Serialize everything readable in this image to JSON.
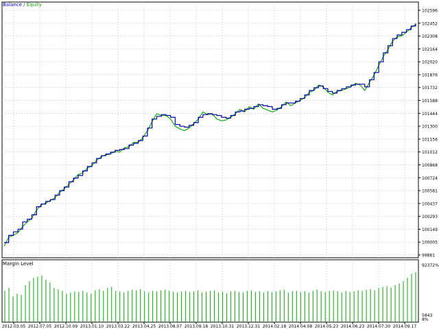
{
  "legend": {
    "balance": "Balance",
    "separator": " / ",
    "equity": "Equity"
  },
  "margin_panel": {
    "title": "Margin Level"
  },
  "colors": {
    "balance": "#0000a0",
    "equity": "#14aa14",
    "margin_bars": "#22aa22",
    "grid": "#c8c8c8",
    "axis": "#000000"
  },
  "chart_data": [
    {
      "type": "line",
      "series": [
        {
          "name": "Balance",
          "values": [
            100000,
            100080,
            100120,
            100150,
            100230,
            100260,
            100310,
            100400,
            100430,
            100460,
            100480,
            100530,
            100580,
            100620,
            100680,
            100720,
            100750,
            100800,
            100850,
            100890,
            100940,
            100970,
            100990,
            101010,
            101030,
            101040,
            101050,
            101090,
            101110,
            101140,
            101190,
            101280,
            101380,
            101410,
            101430,
            101420,
            101400,
            101320,
            101300,
            101290,
            101310,
            101340,
            101400,
            101430,
            101440,
            101430,
            101420,
            101400,
            101390,
            101420,
            101460,
            101470,
            101490,
            101500,
            101520,
            101540,
            101530,
            101520,
            101490,
            101500,
            101540,
            101560,
            101560,
            101580,
            101610,
            101650,
            101700,
            101730,
            101750,
            101720,
            101690,
            101670,
            101700,
            101720,
            101740,
            101760,
            101770,
            101770,
            101740,
            101820,
            101900,
            102020,
            102120,
            102200,
            102280,
            102320,
            102350,
            102380,
            102420,
            102450
          ]
        },
        {
          "name": "Equity",
          "values": [
            99960,
            100060,
            100080,
            100110,
            100180,
            100230,
            100270,
            100360,
            100420,
            100440,
            100470,
            100500,
            100560,
            100600,
            100650,
            100700,
            100760,
            100780,
            100830,
            100860,
            100920,
            100960,
            100980,
            100990,
            101020,
            101010,
            101060,
            101070,
            101120,
            101120,
            101170,
            101250,
            101350,
            101440,
            101420,
            101420,
            101380,
            101300,
            101270,
            101250,
            101280,
            101330,
            101380,
            101460,
            101430,
            101440,
            101380,
            101360,
            101370,
            101400,
            101440,
            101490,
            101460,
            101520,
            101490,
            101550,
            101500,
            101480,
            101460,
            101480,
            101520,
            101570,
            101530,
            101560,
            101590,
            101620,
            101680,
            101700,
            101760,
            101740,
            101680,
            101650,
            101690,
            101700,
            101720,
            101740,
            101780,
            101760,
            101700,
            101790,
            101870,
            101980,
            102080,
            102160,
            102250,
            102300,
            102310,
            102350,
            102400,
            102440
          ]
        }
      ],
      "y_ticks": [
        "102596",
        "102452",
        "102308",
        "102164",
        "102020",
        "101876",
        "101732",
        "101588",
        "101444",
        "101300",
        "101156",
        "101012",
        "100868",
        "100724",
        "100581",
        "100437",
        "100293",
        "100149",
        "100005",
        "99861"
      ],
      "ylim": [
        99861,
        102596
      ]
    },
    {
      "type": "bar",
      "title": "Margin Level",
      "y_ticks": [
        "92372%",
        "5843",
        "8%"
      ],
      "values": [
        55,
        60,
        45,
        50,
        48,
        65,
        72,
        78,
        80,
        82,
        75,
        70,
        60,
        58,
        55,
        50,
        52,
        54,
        53,
        55,
        52,
        50,
        56,
        58,
        55,
        60,
        62,
        55,
        54,
        52,
        55,
        57,
        56,
        58,
        54,
        52,
        55,
        54,
        56,
        57,
        55,
        53,
        52,
        54,
        55,
        53,
        54,
        56,
        52,
        53,
        55,
        56,
        52,
        53,
        51,
        54,
        55,
        53,
        52,
        55,
        56,
        53,
        54,
        52,
        55,
        53,
        54,
        56,
        57,
        52,
        54,
        55,
        53,
        54,
        52,
        55,
        57,
        54,
        53,
        55,
        56,
        54,
        52,
        55,
        53,
        54,
        56,
        55,
        57,
        58,
        56,
        60,
        62,
        63,
        61,
        65,
        68,
        72,
        78,
        85,
        88
      ]
    }
  ],
  "x_ticks": [
    "2012.03.05",
    "2012.07.05",
    "2012.10.09",
    "2013.01.10",
    "2013.03.22",
    "2013.04.25",
    "2013.08.07",
    "2013.09.18",
    "2013.10.31",
    "2013.12.31",
    "2014.02.18",
    "2014.04.08",
    "2014.05.23",
    "2014.06.23",
    "2014.07.30",
    "2014.09.17"
  ]
}
